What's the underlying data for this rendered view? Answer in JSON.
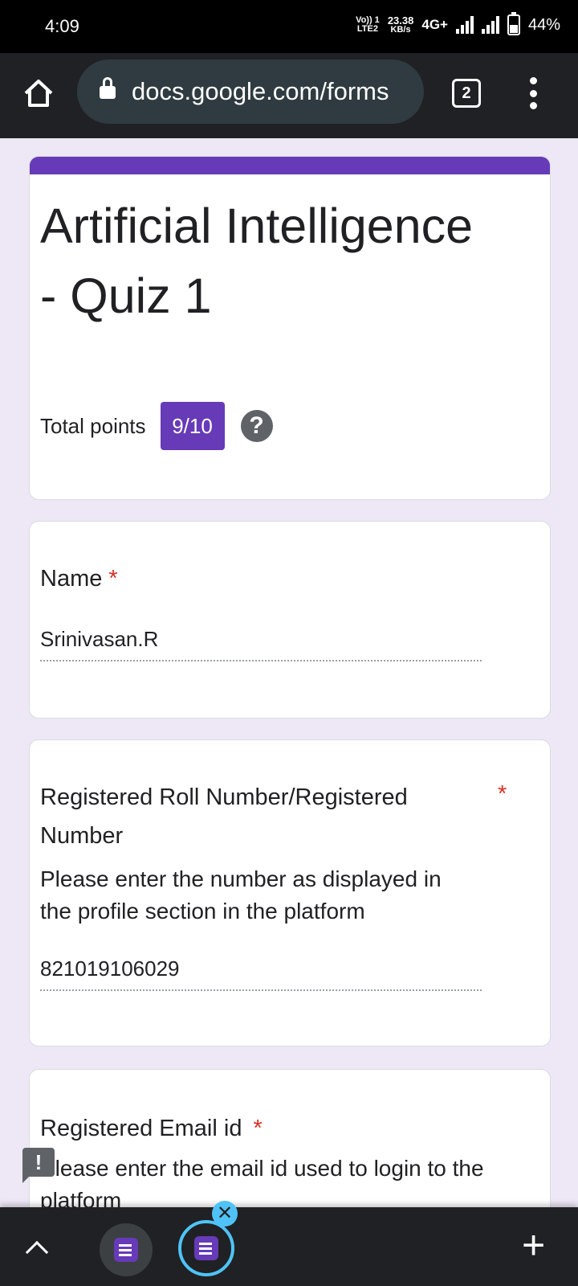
{
  "status_bar": {
    "time": "4:09",
    "volte_top": "Vo)) 1",
    "volte_bottom": "LTE2",
    "speed_value": "23.38",
    "speed_unit": "KB/s",
    "network": "4G+",
    "battery": "44%"
  },
  "browser": {
    "url": "docs.google.com/forms",
    "tab_count": "2"
  },
  "form": {
    "accent_color": "#673ab7",
    "title": "Artificial Intelligence - Quiz 1",
    "total_points_label": "Total points",
    "total_points_value": "9/10",
    "help_symbol": "?"
  },
  "questions": [
    {
      "title": "Name",
      "required_mark": "*",
      "answer": "Srinivasan.R"
    },
    {
      "title": "Registered Roll Number/Registered Number",
      "required_mark": "*",
      "description": "Please enter the number as displayed in the profile section in the platform",
      "answer": "821019106029"
    },
    {
      "title": "Registered Email id",
      "required_mark": "*",
      "description": "Please enter the email id used to login to the platform"
    }
  ],
  "feedback_symbol": "!",
  "bottom_bar": {
    "close_symbol": "✕",
    "new_tab_symbol": "+"
  }
}
